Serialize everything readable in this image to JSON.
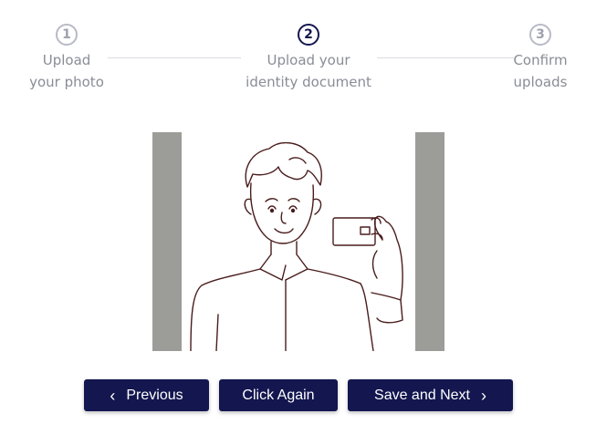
{
  "stepper": {
    "steps": [
      {
        "number": "1",
        "line1": "Upload",
        "line2": "your photo",
        "state": "completed"
      },
      {
        "number": "2",
        "line1": "Upload your",
        "line2": "identity document",
        "state": "active"
      },
      {
        "number": "3",
        "line1": "Confirm",
        "line2": "uploads",
        "state": "pending"
      }
    ]
  },
  "actions": {
    "previous_label": "Previous",
    "click_again_label": "Click Again",
    "save_next_label": "Save and Next",
    "previous_icon": "chevron-left-icon",
    "next_icon": "chevron-right-icon"
  },
  "colors": {
    "primary": "#14164f",
    "muted_text": "#8a8c97",
    "inactive_circle": "#b8bac6"
  }
}
